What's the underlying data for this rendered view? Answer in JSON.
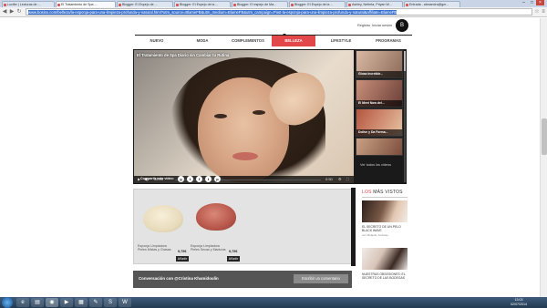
{
  "browser": {
    "tabs": [
      {
        "label": "Lucifer | Lecturas de ...",
        "active": false
      },
      {
        "label": "El Tratamiento de Spa ...",
        "active": true
      },
      {
        "label": "Blogger: El Espejo de ...",
        "active": false
      },
      {
        "label": "Blogger: El Espejo de la ...",
        "active": false
      },
      {
        "label": "Blogger: El espejo de Ma...",
        "active": false
      },
      {
        "label": "Blogger: El Espejo de la ...",
        "active": false
      },
      {
        "label": "Ashley, Neferta, Priyan W...",
        "active": false
      },
      {
        "label": "Entrada - alexandra@gm...",
        "active": false
      }
    ],
    "window_controls": [
      "–",
      "□",
      "×"
    ],
    "url": "www.bosinx.com/belleza/la-esponja-para-una-limpieza-profunda-y-natural.html?utm_source=BlameFB&utm_medium=BlameFB&utm_campaign=Post-la-esponja-para-una-limpieza-profunda-y-natural&affiliate=BlameFB",
    "star_icon": "star-icon",
    "menu_icon": "menu-icon"
  },
  "header": {
    "register": "Registro",
    "login": "Iniciar sesión",
    "logo": "B",
    "nav": [
      {
        "label": "NUEVO",
        "active": false
      },
      {
        "label": "MODA",
        "active": false
      },
      {
        "label": "COMPLEMENTOS",
        "active": false
      },
      {
        "label": "BELLEZA",
        "active": true
      },
      {
        "label": "LIFESTYLE",
        "active": false
      },
      {
        "label": "PROGRAMAS",
        "active": false
      }
    ],
    "accent": "#e2474a"
  },
  "video": {
    "title": "El Tratamiento de Spa Diario sin Cambiar tu Rutina",
    "current_time": "00:09",
    "duration": "0:50",
    "sidebar": [
      {
        "caption": "Glosa increíble..."
      },
      {
        "caption": "El Meet Now del..."
      },
      {
        "caption": "Dolive y Da Forma..."
      },
      {
        "caption": ""
      }
    ],
    "ver_mas": "Ver todos los videos",
    "share_label": "Compartir este video:",
    "social": [
      "g",
      "t",
      "f",
      "t",
      "p"
    ]
  },
  "products": [
    {
      "name": "Esponja Limpiadora Pieles Mixtas y Grasas",
      "price": "9,75€",
      "button": "Añadir"
    },
    {
      "name": "Esponja Limpiadora Pieles Secas y Maduras",
      "price": "9,75€",
      "button": "Añadir"
    }
  ],
  "conversation": {
    "label": "Conversación con @Cristina Khamidoulin",
    "button": "Escribir un comentario"
  },
  "rail": {
    "head_prefix": "LOS",
    "head_main": "MÁS VISTOS",
    "items": [
      {
        "title": "EL SECRETO DE UN PELO BLACK WAVE",
        "byline": "con Mélanie, Andreas"
      },
      {
        "title": "NUESTRAS OBSESIONES: EL SECRETO DE LAS BODEGAS",
        "byline": ""
      }
    ]
  },
  "taskbar": {
    "time": "13:03",
    "date": "02/07/2014",
    "icons": [
      "ie-icon",
      "folder-icon",
      "chrome-icon",
      "media-icon",
      "calc-icon",
      "paint-icon",
      "skype-icon",
      "word-icon"
    ]
  }
}
